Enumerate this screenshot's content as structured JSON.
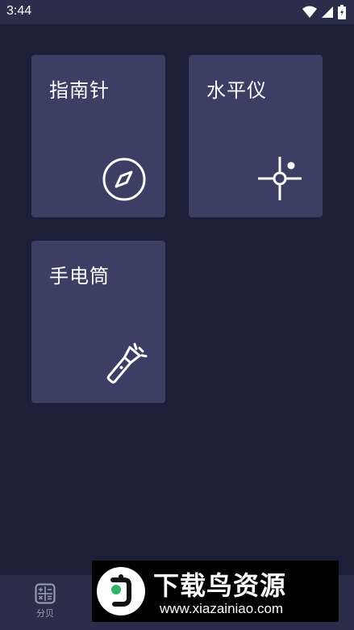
{
  "status_bar": {
    "time": "3:44",
    "icons": [
      "wifi-icon",
      "signal-icon",
      "battery-icon"
    ]
  },
  "tools": [
    {
      "label": "指南针",
      "icon": "compass-icon"
    },
    {
      "label": "水平仪",
      "icon": "level-crosshair-icon"
    },
    {
      "label": "手电筒",
      "icon": "flashlight-icon"
    }
  ],
  "bottom_nav": {
    "items": [
      {
        "label": "分贝",
        "icon": "calculator-icon"
      }
    ]
  },
  "watermark": {
    "title": "下载鸟资源",
    "url": "www.xiazainiao.com"
  },
  "colors": {
    "background": "#1b1f38",
    "tile": "#3a3f63",
    "bars": "#2a2e4a",
    "tab_label": "#9aa0b8"
  }
}
